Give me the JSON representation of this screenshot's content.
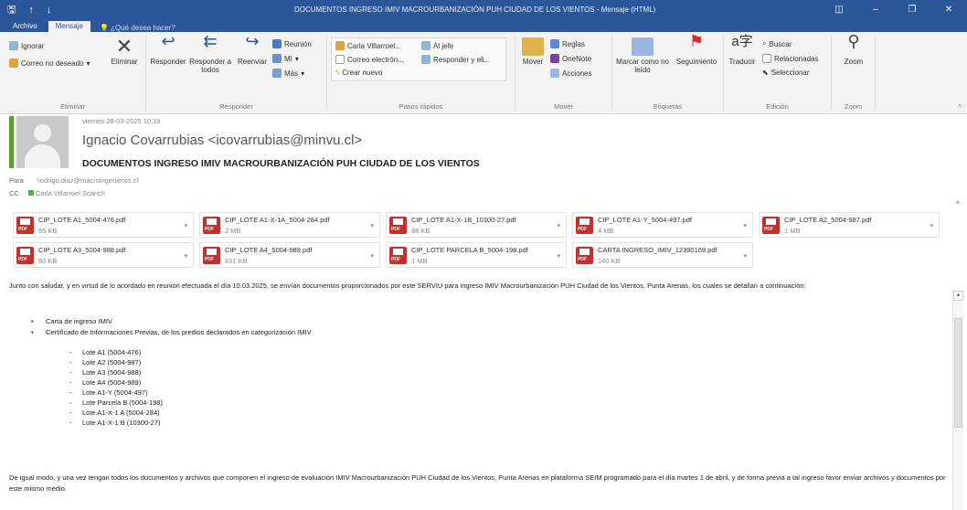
{
  "window": {
    "title": "DOCUMENTOS INGRESO IMIV MACROURBANIZACIÓN PUH CIUDAD DE LOS VIENTOS - Mensaje (HTML)",
    "save_icon": "save-icon",
    "undo_icon": "undo-icon",
    "redo_icon": "redo-icon",
    "accent": "#2b579a"
  },
  "tabs": {
    "archivo": "Archivo",
    "mensaje": "Mensaje",
    "tell": "¿Qué desea hacer?"
  },
  "ribbon": {
    "eliminar_group": {
      "ignorar": "Ignorar",
      "correo_no_deseado": "Correo no deseado",
      "eliminar": "Eliminar",
      "label": "Eliminar"
    },
    "responder_group": {
      "responder": "Responder",
      "responder_todos": "Responder a todos",
      "reenviar": "Reenviar",
      "reunion": "Reunión",
      "mi": "MI",
      "mas": "Más",
      "label": "Responder"
    },
    "pasos_group": {
      "item1": "Carla Villarroel...",
      "item2": "Correo electrón...",
      "item3": "Crear nuevo",
      "item4": "Al jefe",
      "item5": "Responder y eli...",
      "label": "Pasos rápidos"
    },
    "mover_group": {
      "mover": "Mover",
      "reglas": "Reglas",
      "onenote": "OneNote",
      "acciones": "Acciones",
      "label": "Mover"
    },
    "etiquetas_group": {
      "marcar": "Marcar como no leído",
      "seguimiento": "Seguimiento",
      "label": "Etiquetas"
    },
    "edicion_group": {
      "traducir": "Traducir",
      "buscar": "Buscar",
      "relacionadas": "Relacionadas",
      "seleccionar": "Seleccionar",
      "label": "Edición"
    },
    "zoom_group": {
      "zoom": "Zoom",
      "label": "Zoom"
    }
  },
  "message": {
    "date": "viernes 28-03-2025 10:19",
    "sender": "Ignacio Covarrubias <icovarrubias@minvu.cl>",
    "subject": "DOCUMENTOS INGRESO IMIV MACROURBANIZACIÓN PUH CIUDAD DE LOS VIENTOS",
    "to_label": "Para",
    "to_value": "'rodrigo.diaz@macroingenieros.cl'",
    "cc_label": "CC",
    "cc_value": "Carla Villarroel Scarich"
  },
  "attachments": [
    {
      "name": "CIP_LOTE A1_5004-476.pdf",
      "size": "95 KB"
    },
    {
      "name": "CIP_LOTE A1-X-1A_5004-284.pdf",
      "size": "2 MB"
    },
    {
      "name": "CIP_LOTE A1-X-1B_10300-27.pdf",
      "size": "88 KB"
    },
    {
      "name": "CIP_LOTE A1-Y_5004-497.pdf",
      "size": "4 MB"
    },
    {
      "name": "CIP_LOTE A2_5004-987.pdf",
      "size": "1 MB"
    },
    {
      "name": "CIP_LOTE A3_5004-988.pdf",
      "size": "92 KB"
    },
    {
      "name": "CIP_LOTE A4_5004-989.pdf",
      "size": "831 KB"
    },
    {
      "name": "CIP_LOTE PARCELA B_5004-198.pdf",
      "size": "1 MB"
    },
    {
      "name": "CARTA INGRESO_IMIV_12390169.pdf",
      "size": "140 KB"
    }
  ],
  "body": {
    "intro": "Junto con saludar, y en virtud de lo acordado en reunión efectuada el día 10.03.2025, se envían documentos proporcionados por este SERVIU para ingreso IMIV Macrourbanización PUH Ciudad de los Vientos, Punta Arenas, los cuales se detallan a continuación:",
    "bullet1": "Carta de ingreso IMIV",
    "bullet2": "Certificado de Informaciones Previas, de los predios declarados en categorización IMIV",
    "lotes": [
      "Lote A1 (5004-476)",
      "Lote A2 (5004-987)",
      "Lote A3 (5004-988)",
      "Lote A4 (5004-989)",
      "Lote A1-Y (5004-497)",
      "Lote Parcela B (5004-198)",
      "Lote A1-X-1 A (5004-284)",
      "Lote A1-X-1 B (10300-27)"
    ],
    "closing": "De igual modo, y una vez tengan todos los documentos y archivos que componen el ingreso de evaluación IMIV Macrourbanización PUH Ciudad de los Vientos, Punta Arenas en plataforma SEIM programado para el día martes 1 de abril, y de forma previa a tal ingreso favor enviar archivos y documentos por este mismo medio."
  }
}
